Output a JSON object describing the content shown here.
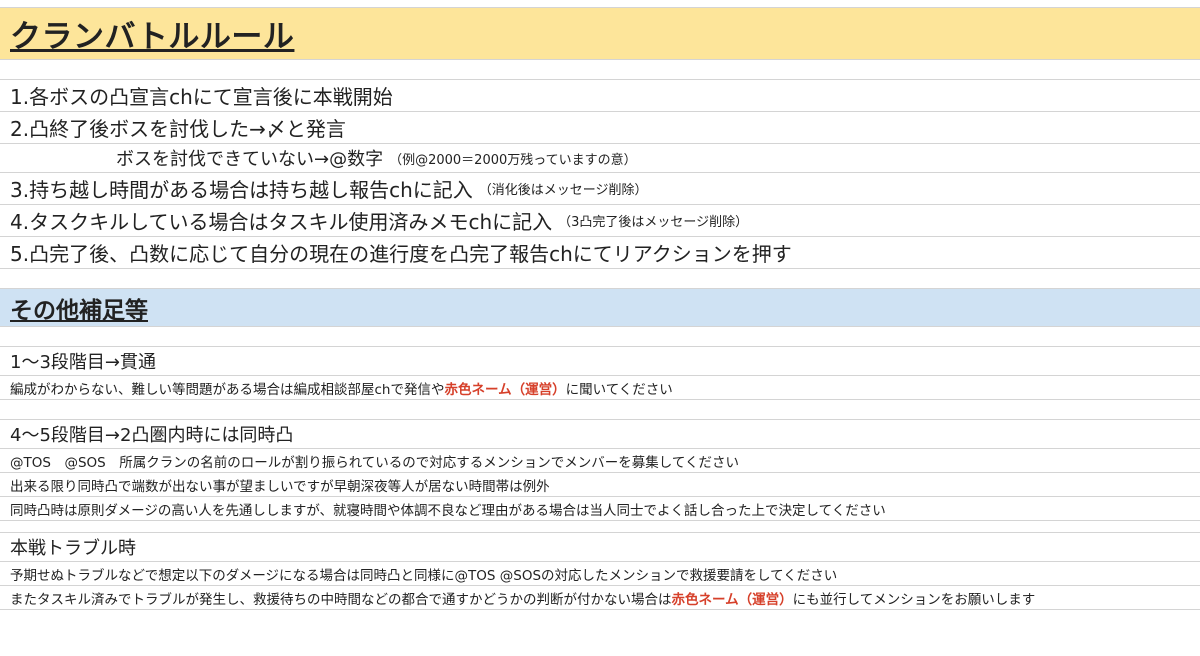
{
  "section1": {
    "title": "クランバトルルール",
    "rules": {
      "r1": "1.各ボスの凸宣言chにて宣言後に本戦開始",
      "r2": "2.凸終了後ボスを討伐した→〆と発言",
      "r2b": "ボスを討伐できていない→@数字",
      "r2b_note": "（例@2000＝2000万残っていますの意）",
      "r3": "3.持ち越し時間がある場合は持ち越し報告chに記入",
      "r3_note": "（消化後はメッセージ削除）",
      "r4": "4.タスクキルしている場合はタスキル使用済みメモchに記入",
      "r4_note": "（3凸完了後はメッセージ削除）",
      "r5": "5.凸完了後、凸数に応じて自分の現在の進行度を凸完了報告chにてリアクションを押す"
    }
  },
  "section2": {
    "title": "その他補足等",
    "block1": {
      "heading": "1〜3段階目→貫通",
      "line1_pre": "編成がわからない、難しい等問題がある場合は編成相談部屋chで発信や",
      "line1_red": "赤色ネーム（運営）",
      "line1_post": "に聞いてください"
    },
    "block2": {
      "heading": "4〜5段階目→2凸圏内時には同時凸",
      "line1": "@TOS　@SOS　所属クランの名前のロールが割り振られているので対応するメンションでメンバーを募集してください",
      "line2": "出来る限り同時凸で端数が出ない事が望ましいですが早朝深夜等人が居ない時間帯は例外",
      "line3": "同時凸時は原則ダメージの高い人を先通ししますが、就寝時間や体調不良など理由がある場合は当人同士でよく話し合った上で決定してください"
    },
    "block3": {
      "heading": "本戦トラブル時",
      "line1": "予期せぬトラブルなどで想定以下のダメージになる場合は同時凸と同様に@TOS @SOSの対応したメンションで救援要請をしてください",
      "line2_pre": "またタスキル済みでトラブルが発生し、救援待ちの中時間などの都合で通すかどうかの判断が付かない場合は",
      "line2_red": "赤色ネーム（運営）",
      "line2_post": "にも並行してメンションをお願いします"
    }
  },
  "colors": {
    "rule_header_bg": "#fde59a",
    "other_header_bg": "#cfe2f3",
    "emphasis_red": "#d6402a",
    "grid_line": "#d4d4d4"
  }
}
